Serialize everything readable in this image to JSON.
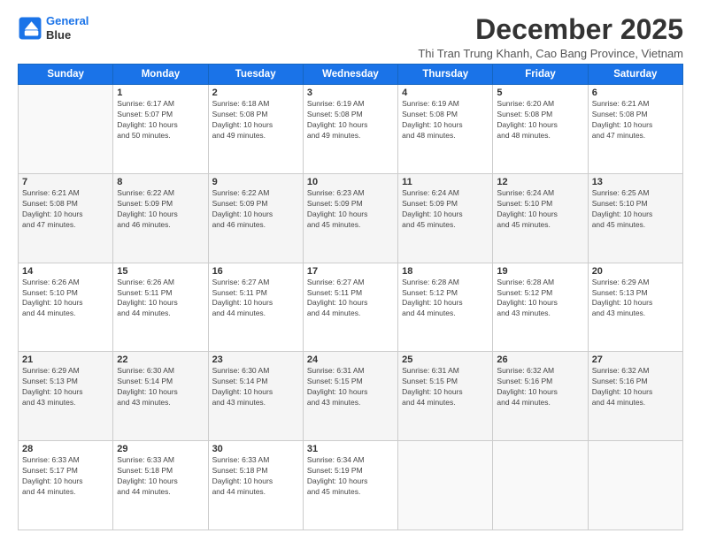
{
  "header": {
    "logo_line1": "General",
    "logo_line2": "Blue",
    "month_title": "December 2025",
    "subtitle": "Thi Tran Trung Khanh, Cao Bang Province, Vietnam"
  },
  "weekdays": [
    "Sunday",
    "Monday",
    "Tuesday",
    "Wednesday",
    "Thursday",
    "Friday",
    "Saturday"
  ],
  "weeks": [
    {
      "days": [
        {
          "num": "",
          "detail": ""
        },
        {
          "num": "1",
          "detail": "Sunrise: 6:17 AM\nSunset: 5:07 PM\nDaylight: 10 hours\nand 50 minutes."
        },
        {
          "num": "2",
          "detail": "Sunrise: 6:18 AM\nSunset: 5:08 PM\nDaylight: 10 hours\nand 49 minutes."
        },
        {
          "num": "3",
          "detail": "Sunrise: 6:19 AM\nSunset: 5:08 PM\nDaylight: 10 hours\nand 49 minutes."
        },
        {
          "num": "4",
          "detail": "Sunrise: 6:19 AM\nSunset: 5:08 PM\nDaylight: 10 hours\nand 48 minutes."
        },
        {
          "num": "5",
          "detail": "Sunrise: 6:20 AM\nSunset: 5:08 PM\nDaylight: 10 hours\nand 48 minutes."
        },
        {
          "num": "6",
          "detail": "Sunrise: 6:21 AM\nSunset: 5:08 PM\nDaylight: 10 hours\nand 47 minutes."
        }
      ]
    },
    {
      "days": [
        {
          "num": "7",
          "detail": "Sunrise: 6:21 AM\nSunset: 5:08 PM\nDaylight: 10 hours\nand 47 minutes."
        },
        {
          "num": "8",
          "detail": "Sunrise: 6:22 AM\nSunset: 5:09 PM\nDaylight: 10 hours\nand 46 minutes."
        },
        {
          "num": "9",
          "detail": "Sunrise: 6:22 AM\nSunset: 5:09 PM\nDaylight: 10 hours\nand 46 minutes."
        },
        {
          "num": "10",
          "detail": "Sunrise: 6:23 AM\nSunset: 5:09 PM\nDaylight: 10 hours\nand 45 minutes."
        },
        {
          "num": "11",
          "detail": "Sunrise: 6:24 AM\nSunset: 5:09 PM\nDaylight: 10 hours\nand 45 minutes."
        },
        {
          "num": "12",
          "detail": "Sunrise: 6:24 AM\nSunset: 5:10 PM\nDaylight: 10 hours\nand 45 minutes."
        },
        {
          "num": "13",
          "detail": "Sunrise: 6:25 AM\nSunset: 5:10 PM\nDaylight: 10 hours\nand 45 minutes."
        }
      ]
    },
    {
      "days": [
        {
          "num": "14",
          "detail": "Sunrise: 6:26 AM\nSunset: 5:10 PM\nDaylight: 10 hours\nand 44 minutes."
        },
        {
          "num": "15",
          "detail": "Sunrise: 6:26 AM\nSunset: 5:11 PM\nDaylight: 10 hours\nand 44 minutes."
        },
        {
          "num": "16",
          "detail": "Sunrise: 6:27 AM\nSunset: 5:11 PM\nDaylight: 10 hours\nand 44 minutes."
        },
        {
          "num": "17",
          "detail": "Sunrise: 6:27 AM\nSunset: 5:11 PM\nDaylight: 10 hours\nand 44 minutes."
        },
        {
          "num": "18",
          "detail": "Sunrise: 6:28 AM\nSunset: 5:12 PM\nDaylight: 10 hours\nand 44 minutes."
        },
        {
          "num": "19",
          "detail": "Sunrise: 6:28 AM\nSunset: 5:12 PM\nDaylight: 10 hours\nand 43 minutes."
        },
        {
          "num": "20",
          "detail": "Sunrise: 6:29 AM\nSunset: 5:13 PM\nDaylight: 10 hours\nand 43 minutes."
        }
      ]
    },
    {
      "days": [
        {
          "num": "21",
          "detail": "Sunrise: 6:29 AM\nSunset: 5:13 PM\nDaylight: 10 hours\nand 43 minutes."
        },
        {
          "num": "22",
          "detail": "Sunrise: 6:30 AM\nSunset: 5:14 PM\nDaylight: 10 hours\nand 43 minutes."
        },
        {
          "num": "23",
          "detail": "Sunrise: 6:30 AM\nSunset: 5:14 PM\nDaylight: 10 hours\nand 43 minutes."
        },
        {
          "num": "24",
          "detail": "Sunrise: 6:31 AM\nSunset: 5:15 PM\nDaylight: 10 hours\nand 43 minutes."
        },
        {
          "num": "25",
          "detail": "Sunrise: 6:31 AM\nSunset: 5:15 PM\nDaylight: 10 hours\nand 44 minutes."
        },
        {
          "num": "26",
          "detail": "Sunrise: 6:32 AM\nSunset: 5:16 PM\nDaylight: 10 hours\nand 44 minutes."
        },
        {
          "num": "27",
          "detail": "Sunrise: 6:32 AM\nSunset: 5:16 PM\nDaylight: 10 hours\nand 44 minutes."
        }
      ]
    },
    {
      "days": [
        {
          "num": "28",
          "detail": "Sunrise: 6:33 AM\nSunset: 5:17 PM\nDaylight: 10 hours\nand 44 minutes."
        },
        {
          "num": "29",
          "detail": "Sunrise: 6:33 AM\nSunset: 5:18 PM\nDaylight: 10 hours\nand 44 minutes."
        },
        {
          "num": "30",
          "detail": "Sunrise: 6:33 AM\nSunset: 5:18 PM\nDaylight: 10 hours\nand 44 minutes."
        },
        {
          "num": "31",
          "detail": "Sunrise: 6:34 AM\nSunset: 5:19 PM\nDaylight: 10 hours\nand 45 minutes."
        },
        {
          "num": "",
          "detail": ""
        },
        {
          "num": "",
          "detail": ""
        },
        {
          "num": "",
          "detail": ""
        }
      ]
    }
  ]
}
